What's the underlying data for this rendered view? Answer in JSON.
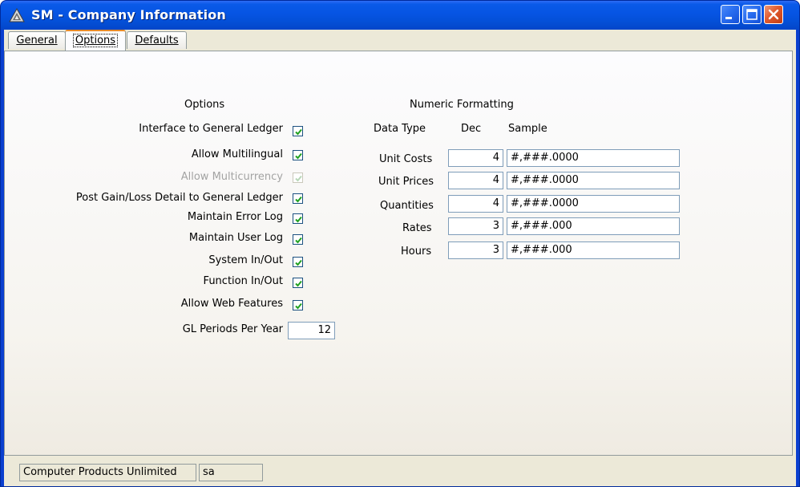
{
  "window": {
    "title": "SM - Company Information",
    "icon": "app-triangle-icon",
    "controls": {
      "minimize": "minimize-icon",
      "maximize": "maximize-icon",
      "close": "close-icon"
    }
  },
  "tabs": [
    {
      "label": "General",
      "active": false
    },
    {
      "label": "Options",
      "active": true
    },
    {
      "label": "Defaults",
      "active": false
    }
  ],
  "options": {
    "heading": "Options",
    "items": [
      {
        "label": "Interface to General Ledger",
        "checked": true,
        "enabled": true
      },
      {
        "label": "Allow Multilingual",
        "checked": true,
        "enabled": true
      },
      {
        "label": "Allow Multicurrency",
        "checked": true,
        "enabled": false
      },
      {
        "label": "Post Gain/Loss Detail to General Ledger",
        "checked": true,
        "enabled": true
      },
      {
        "label": "Maintain Error Log",
        "checked": true,
        "enabled": true
      },
      {
        "label": "Maintain User Log",
        "checked": true,
        "enabled": true
      },
      {
        "label": "System In/Out",
        "checked": true,
        "enabled": true
      },
      {
        "label": "Function In/Out",
        "checked": true,
        "enabled": true
      },
      {
        "label": "Allow Web Features",
        "checked": true,
        "enabled": true
      }
    ],
    "gl_periods_label": "GL Periods Per Year",
    "gl_periods_value": "12"
  },
  "numeric_formatting": {
    "heading": "Numeric Formatting",
    "col_data_type": "Data Type",
    "col_dec": "Dec",
    "col_sample": "Sample",
    "rows": [
      {
        "label": "Unit Costs",
        "dec": "4",
        "sample": "#,###.0000"
      },
      {
        "label": "Unit Prices",
        "dec": "4",
        "sample": "#,###.0000"
      },
      {
        "label": "Quantities",
        "dec": "4",
        "sample": "#,###.0000"
      },
      {
        "label": "Rates",
        "dec": "3",
        "sample": "#,###.000"
      },
      {
        "label": "Hours",
        "dec": "3",
        "sample": "#,###.000"
      }
    ]
  },
  "status": {
    "company": "Computer Products Unlimited",
    "user": "sa"
  },
  "colors": {
    "titlebar": "#0454e0",
    "active_tab_accent": "#e68b2c",
    "checkmark": "#21a121",
    "close_button": "#e05a2e"
  }
}
